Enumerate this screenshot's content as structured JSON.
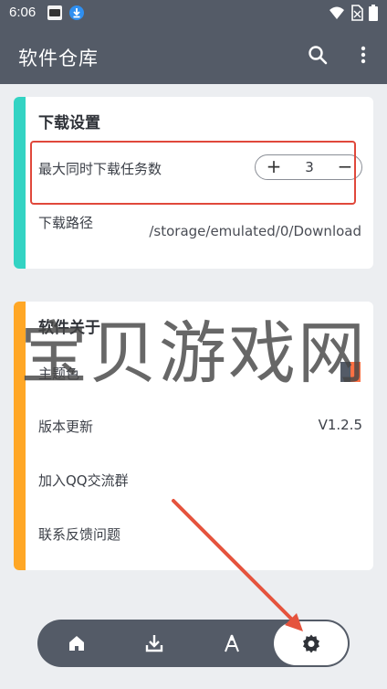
{
  "status_bar": {
    "time": "6:06"
  },
  "app_bar": {
    "title": "软件仓库",
    "search_icon": "search-icon",
    "more_icon": "more-vert-icon"
  },
  "download_settings": {
    "title": "下载设置",
    "max_tasks_label": "最大同时下载任务数",
    "max_tasks_value": "3",
    "path_label": "下载路径",
    "path_value": "/storage/emulated/0/Download",
    "accent": "#33d3c3"
  },
  "about": {
    "title": "软件关于",
    "theme_label": "主题色",
    "theme_colors": [
      "#545b67",
      "#ff7043"
    ],
    "version_label": "版本更新",
    "version_value": "V1.2.5",
    "qq_group_label": "加入QQ交流群",
    "feedback_label": "联系反馈问题",
    "accent": "#ffa726"
  },
  "watermark": "宝贝游戏网",
  "bottom_nav": {
    "items": [
      "home-icon",
      "download-icon",
      "app-store-icon",
      "settings-icon"
    ],
    "active": "settings-icon"
  },
  "colors": {
    "primary": "#545b67",
    "highlight_box": "#e0483b",
    "background": "#eceef1"
  }
}
